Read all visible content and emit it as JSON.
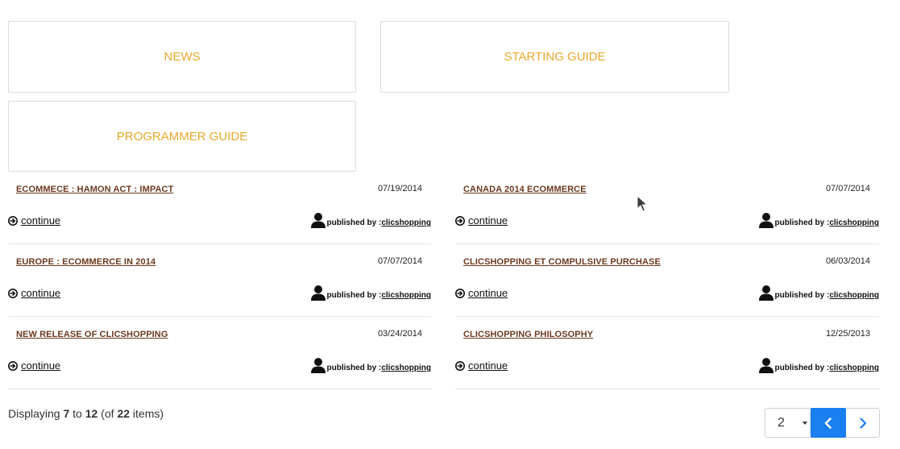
{
  "categories": {
    "news": "NEWS",
    "starting_guide": "STARTING GUIDE",
    "programmer_guide": "PROGRAMMER GUIDE"
  },
  "articles": [
    {
      "title": "ECOMMECE : HAMON ACT : IMPACT",
      "date": "07/19/2014",
      "continue": "continue",
      "published_by": "published by :",
      "author": "clicshopping"
    },
    {
      "title": "CANADA 2014 ECOMMERCE",
      "date": "07/07/2014",
      "continue": "continue",
      "published_by": "published by :",
      "author": "clicshopping"
    },
    {
      "title": "EUROPE : ECOMMERCE IN 2014",
      "date": "07/07/2014",
      "continue": "continue",
      "published_by": "published by :",
      "author": "clicshopping"
    },
    {
      "title": "CLICSHOPPING ET COMPULSIVE PURCHASE",
      "date": "06/03/2014",
      "continue": "continue",
      "published_by": "published by :",
      "author": "clicshopping"
    },
    {
      "title": "NEW RELEASE OF CLICSHOPPING",
      "date": "03/24/2014",
      "continue": "continue",
      "published_by": "published by :",
      "author": "clicshopping"
    },
    {
      "title": "CLICSHOPPING PHILOSOPHY",
      "date": "12/25/2013",
      "continue": "continue",
      "published_by": "published by :",
      "author": "clicshopping"
    }
  ],
  "pagination": {
    "displaying_prefix": "Displaying ",
    "from": "7",
    "to_word": " to ",
    "to": "12",
    "of_prefix": " (of ",
    "total": "22",
    "items_suffix": " items)",
    "current_page": "2"
  },
  "icons": {
    "continue": "circle-arrow-right-icon",
    "author": "user-icon",
    "select_caret": "caret-down-icon",
    "prev": "chevron-left-icon",
    "next": "chevron-right-icon",
    "cursor": "mouse-pointer-icon"
  },
  "colors": {
    "category_text": "#e8a82a",
    "article_title": "#6b3a1f",
    "prev_button": "#1a7ff0",
    "next_chevron": "#1a7ff0"
  }
}
